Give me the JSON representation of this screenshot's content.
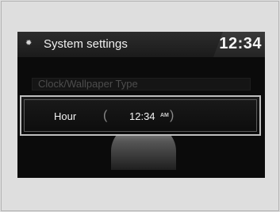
{
  "header": {
    "icon": "gear-icon",
    "title": "System settings",
    "clock": "12:34"
  },
  "menu": {
    "item_label": "Clock/Wallpaper Type"
  },
  "hour_setting": {
    "label": "Hour",
    "value": "12:34",
    "ampm": "AM",
    "left_bracket": "(",
    "right_bracket": ")"
  }
}
